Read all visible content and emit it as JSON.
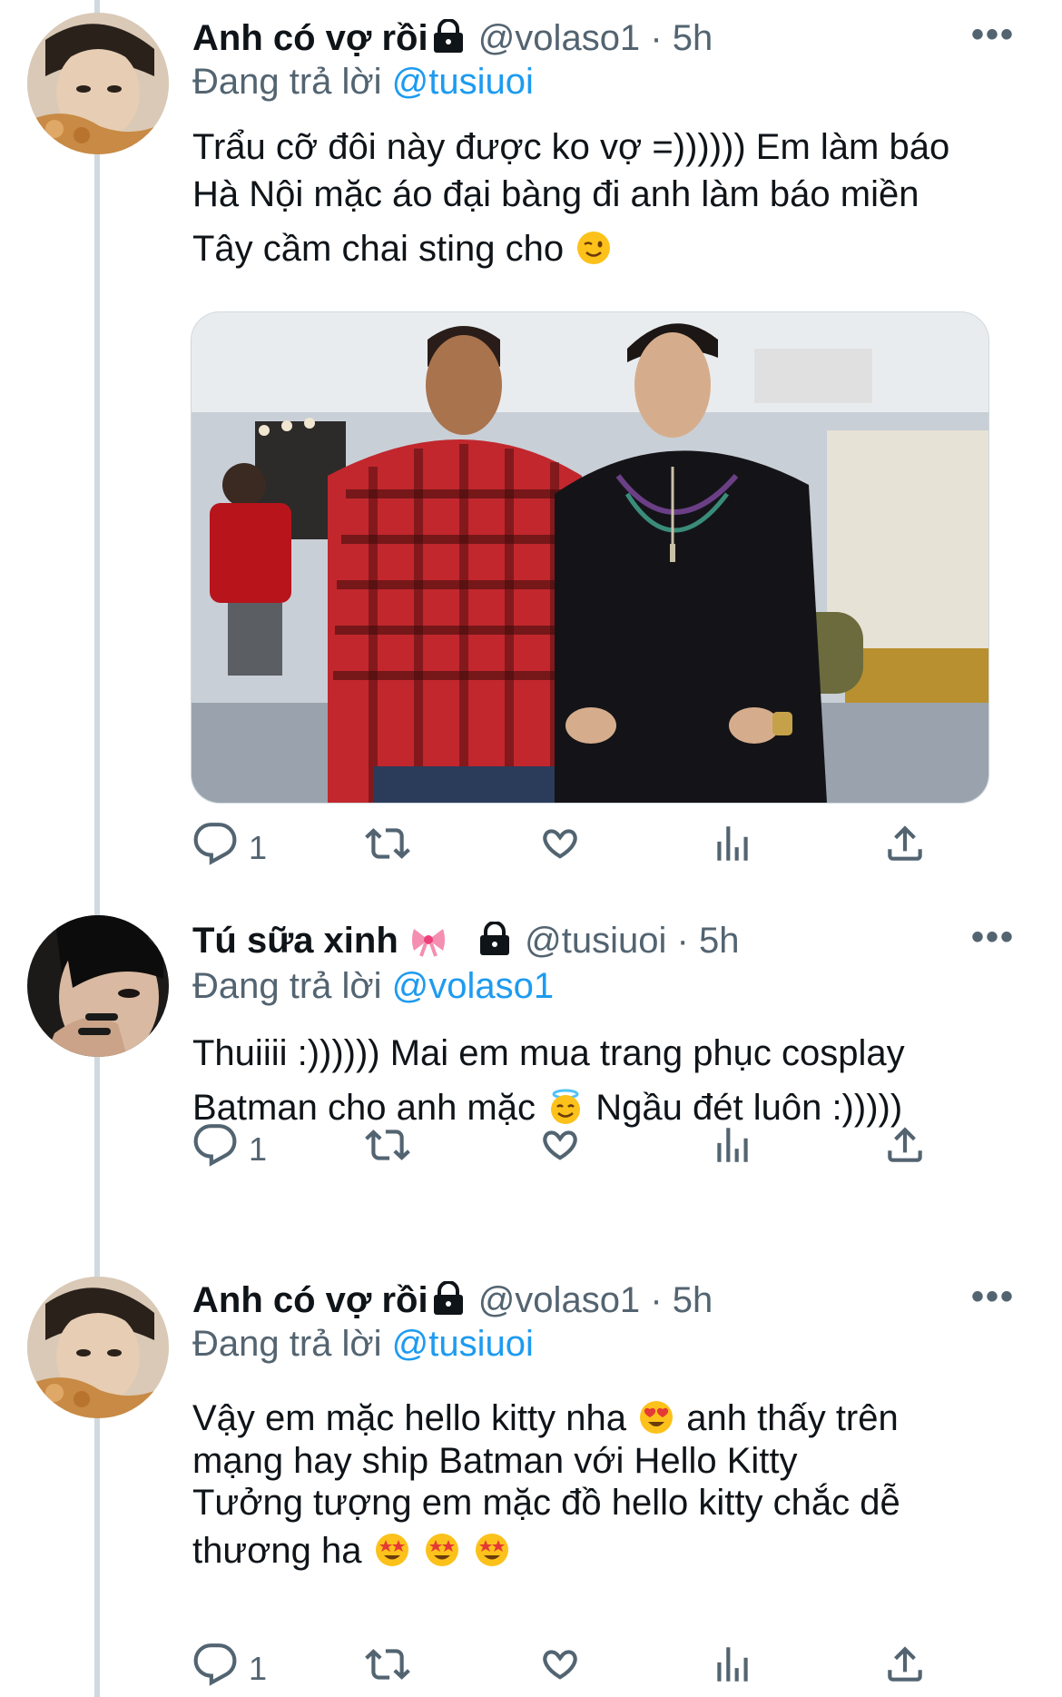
{
  "tweets": [
    {
      "name": "Anh có vợ rồi",
      "handle": "@volaso1",
      "separator": "·",
      "time": "5h",
      "replying_prefix": "Đang trả lời",
      "replying_to": "@tusiuoi",
      "text_lines": [
        "Trẩu cỡ đôi này được ko vợ =)))))) Em làm báo",
        "Hà Nội mặc áo đại bàng đi anh làm báo miền",
        "Tây cầm chai sting cho"
      ],
      "emojis": [
        "winking-face"
      ],
      "reply_count": "1",
      "has_media": true
    },
    {
      "name": "Tú sữa xinh",
      "handle": "@tusiuoi",
      "separator": "·",
      "time": "5h",
      "replying_prefix": "Đang trả lời",
      "replying_to": "@volaso1",
      "text_lines": [
        "Thuiiii :)))))) Mai em mua trang phục cosplay",
        "Batman cho anh mặc",
        "Ngầu đét luôn :)))))"
      ],
      "emojis": [
        "ribbon",
        "smiling-face-with-halo"
      ],
      "reply_count": "1",
      "has_media": false
    },
    {
      "name": "Anh có vợ rồi",
      "handle": "@volaso1",
      "separator": "·",
      "time": "5h",
      "replying_prefix": "Đang trả lời",
      "replying_to": "@tusiuoi",
      "text_lines": [
        "Vậy em mặc hello kitty nha",
        "anh thấy trên",
        "mạng hay ship Batman với Hello Kitty",
        "Tưởng tượng em mặc đồ hello kitty chắc dễ",
        "thương ha"
      ],
      "emojis": [
        "heart-eyes",
        "star-struck",
        "star-struck",
        "star-struck"
      ],
      "reply_count": "1",
      "has_media": false
    }
  ],
  "more_label": "•••",
  "colors": {
    "accent": "#1d9bf0",
    "secondary_text": "#536471",
    "primary_text": "#0f1419",
    "thread_line": "#cfd9de"
  },
  "icons": [
    "reply-icon",
    "retweet-icon",
    "like-icon",
    "analytics-icon",
    "share-icon",
    "lock-icon",
    "more-icon"
  ]
}
